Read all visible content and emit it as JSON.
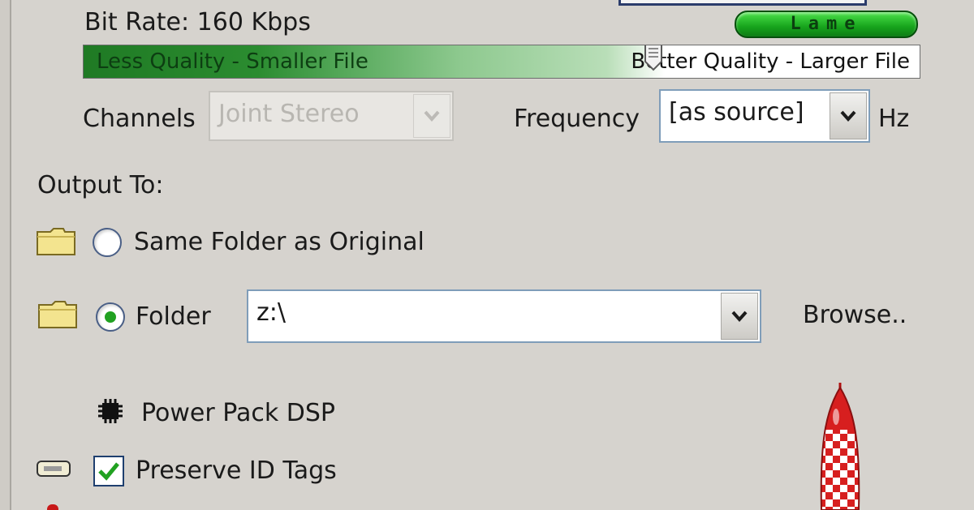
{
  "encoder": {
    "bitrate_label": "Bit Rate: 160 Kbps",
    "logo_text": "Lame",
    "quality_slider": {
      "left_label": "Less Quality - Smaller File",
      "right_label": "Better Quality - Larger File",
      "position_fraction": 0.68
    },
    "channels": {
      "label": "Channels",
      "value": "Joint Stereo",
      "enabled": false
    },
    "frequency": {
      "label": "Frequency",
      "value": "[as source]",
      "unit": "Hz"
    }
  },
  "output": {
    "heading": "Output To:",
    "same_folder_label": "Same Folder as Original",
    "folder_label": "Folder",
    "selected": "folder",
    "folder_path": "z:\\",
    "browse_label": "Browse.."
  },
  "dsp": {
    "label": "Power Pack DSP"
  },
  "id_tags": {
    "label": "Preserve ID Tags",
    "checked": true
  },
  "colors": {
    "window_bg": "#d6d3ce",
    "accent_green": "#21a121",
    "slider_dark": "#1f7a24",
    "border_blue": "#7f9db9",
    "rocket_red": "#d71f1f"
  },
  "icons": [
    "folder-icon",
    "chip-icon",
    "tag-icon",
    "rocket-icon",
    "lame-logo",
    "chevron-down-icon"
  ]
}
